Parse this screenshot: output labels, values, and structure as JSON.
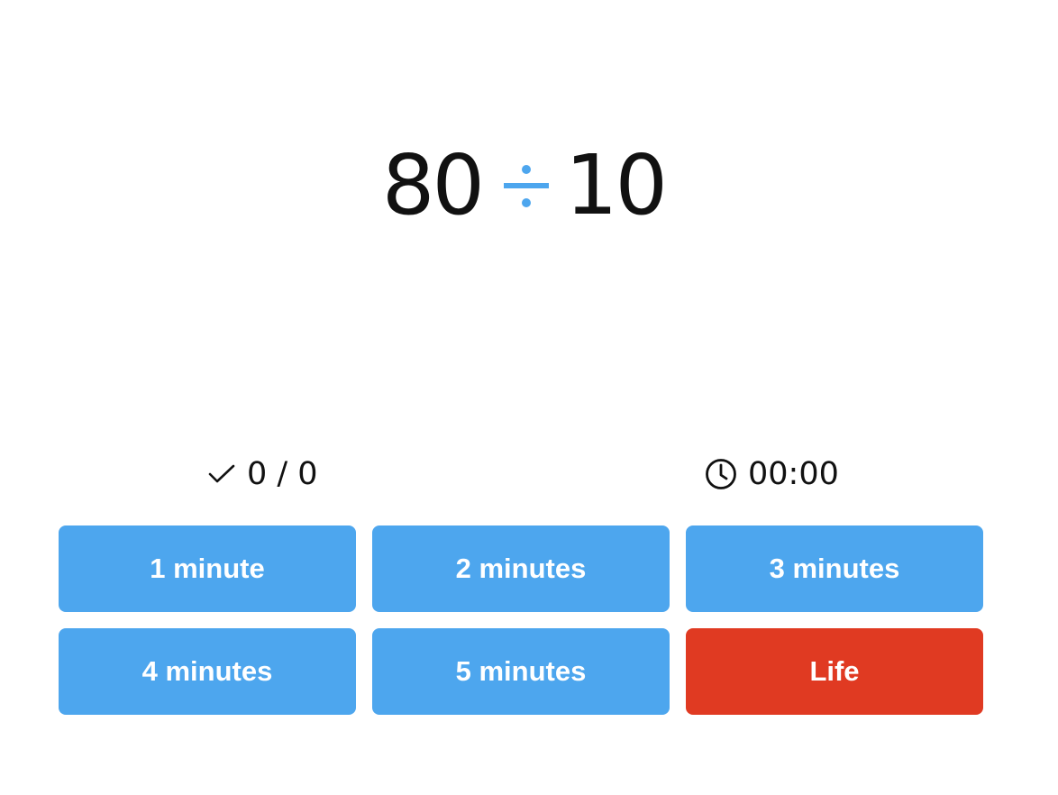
{
  "problem": {
    "operand_a": "80",
    "operator": "÷",
    "operand_b": "10",
    "operator_color": "#4da6ee"
  },
  "stats": {
    "score_icon": "check-icon",
    "score": "0 / 0",
    "timer_icon": "clock-icon",
    "timer": "00:00"
  },
  "buttons": [
    {
      "label": "1 minute",
      "color": "#4da6ee"
    },
    {
      "label": "2 minutes",
      "color": "#4da6ee"
    },
    {
      "label": "3 minutes",
      "color": "#4da6ee"
    },
    {
      "label": "4 minutes",
      "color": "#4da6ee"
    },
    {
      "label": "5 minutes",
      "color": "#4da6ee"
    },
    {
      "label": "Life",
      "color": "#e03a22"
    }
  ]
}
